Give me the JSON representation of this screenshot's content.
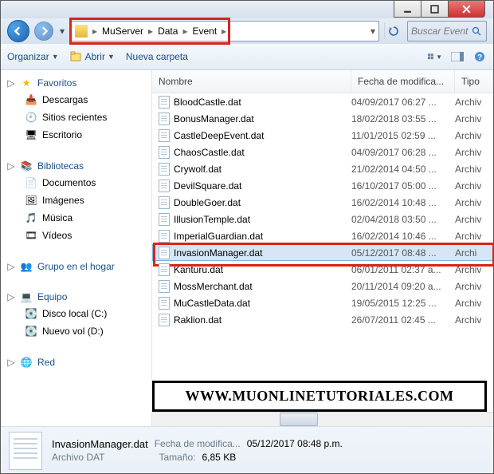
{
  "breadcrumb": [
    "MuServer",
    "Data",
    "Event"
  ],
  "search": {
    "placeholder": "Buscar Event"
  },
  "toolbar": {
    "organizar": "Organizar",
    "abrir": "Abrir",
    "nueva_carpeta": "Nueva carpeta"
  },
  "columns": {
    "name": "Nombre",
    "date": "Fecha de modifica...",
    "type": "Tipo"
  },
  "sidebar": {
    "fav": {
      "head": "Favoritos",
      "items": [
        "Descargas",
        "Sitios recientes",
        "Escritorio"
      ]
    },
    "lib": {
      "head": "Bibliotecas",
      "items": [
        "Documentos",
        "Imágenes",
        "Música",
        "Vídeos"
      ]
    },
    "home": {
      "head": "Grupo en el hogar"
    },
    "equipo": {
      "head": "Equipo",
      "items": [
        "Disco local (C:)",
        "Nuevo vol (D:)"
      ]
    },
    "red": {
      "head": "Red"
    }
  },
  "files": [
    {
      "name": "BloodCastle.dat",
      "date": "04/09/2017 06:27 ...",
      "type": "Archiv"
    },
    {
      "name": "BonusManager.dat",
      "date": "18/02/2018 03:55 ...",
      "type": "Archiv"
    },
    {
      "name": "CastleDeepEvent.dat",
      "date": "11/01/2015 02:59 ...",
      "type": "Archiv"
    },
    {
      "name": "ChaosCastle.dat",
      "date": "04/09/2017 06:28 ...",
      "type": "Archiv"
    },
    {
      "name": "Crywolf.dat",
      "date": "21/02/2014 04:50 ...",
      "type": "Archiv"
    },
    {
      "name": "DevilSquare.dat",
      "date": "16/10/2017 05:00 ...",
      "type": "Archiv"
    },
    {
      "name": "DoubleGoer.dat",
      "date": "16/02/2014 10:48 ...",
      "type": "Archiv"
    },
    {
      "name": "IllusionTemple.dat",
      "date": "02/04/2018 03:50 ...",
      "type": "Archiv"
    },
    {
      "name": "ImperialGuardian.dat",
      "date": "16/02/2014 10:46 ...",
      "type": "Archiv"
    },
    {
      "name": "InvasionManager.dat",
      "date": "05/12/2017 08:48 ...",
      "type": "Archi",
      "selected": true
    },
    {
      "name": "Kanturu.dat",
      "date": "06/01/2011 02:37 a...",
      "type": "Archiv"
    },
    {
      "name": "MossMerchant.dat",
      "date": "20/11/2014 09:20 a...",
      "type": "Archiv"
    },
    {
      "name": "MuCastleData.dat",
      "date": "19/05/2015 12:25 ...",
      "type": "Archiv"
    },
    {
      "name": "Raklion.dat",
      "date": "26/07/2011 02:45 ...",
      "type": "Archiv"
    }
  ],
  "watermark": "WWW.MUONLINETUTORIALES.COM",
  "details": {
    "name": "InvasionManager.dat",
    "type": "Archivo DAT",
    "date_label": "Fecha de modifica...",
    "date_value": "05/12/2017 08:48 p.m.",
    "size_label": "Tamaño:",
    "size_value": "6,85 KB"
  }
}
